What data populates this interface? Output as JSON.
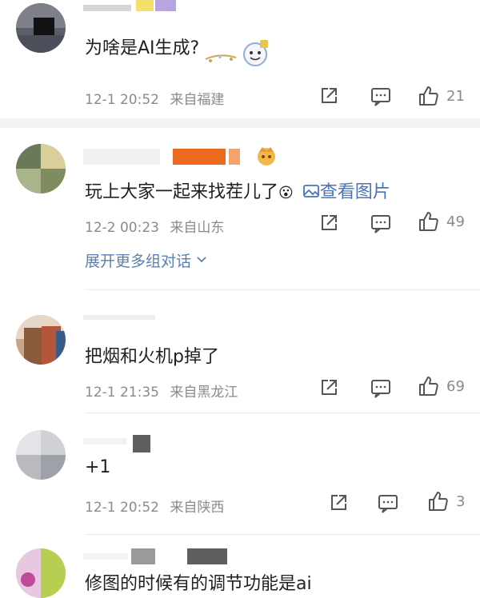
{
  "comments": [
    {
      "text": "为啥是AI生成?",
      "time": "12-1 20:52",
      "location": "来自福建",
      "likes": "21"
    },
    {
      "text": "玩上大家一起来找茬儿了",
      "emoji": "😮",
      "image_link": "查看图片",
      "time": "12-2 00:23",
      "location": "来自山东",
      "likes": "49",
      "expand_label": "展开更多组对话"
    },
    {
      "text": "把烟和火机p掉了",
      "time": "12-1 21:35",
      "location": "来自黑龙江",
      "likes": "69"
    },
    {
      "text": "+1",
      "time": "12-1 20:52",
      "location": "来自陕西",
      "likes": "3"
    },
    {
      "text": "修图的时候有的调节功能是ai"
    }
  ],
  "icons": {
    "share": "share-icon",
    "comment": "comment-icon",
    "like": "thumbs-up-icon",
    "expand": "chevron-down-icon",
    "image": "image-icon"
  },
  "colors": {
    "link": "#5b7fae",
    "meta": "#8a8a8a",
    "badge_orange": "#ee6a1f"
  }
}
